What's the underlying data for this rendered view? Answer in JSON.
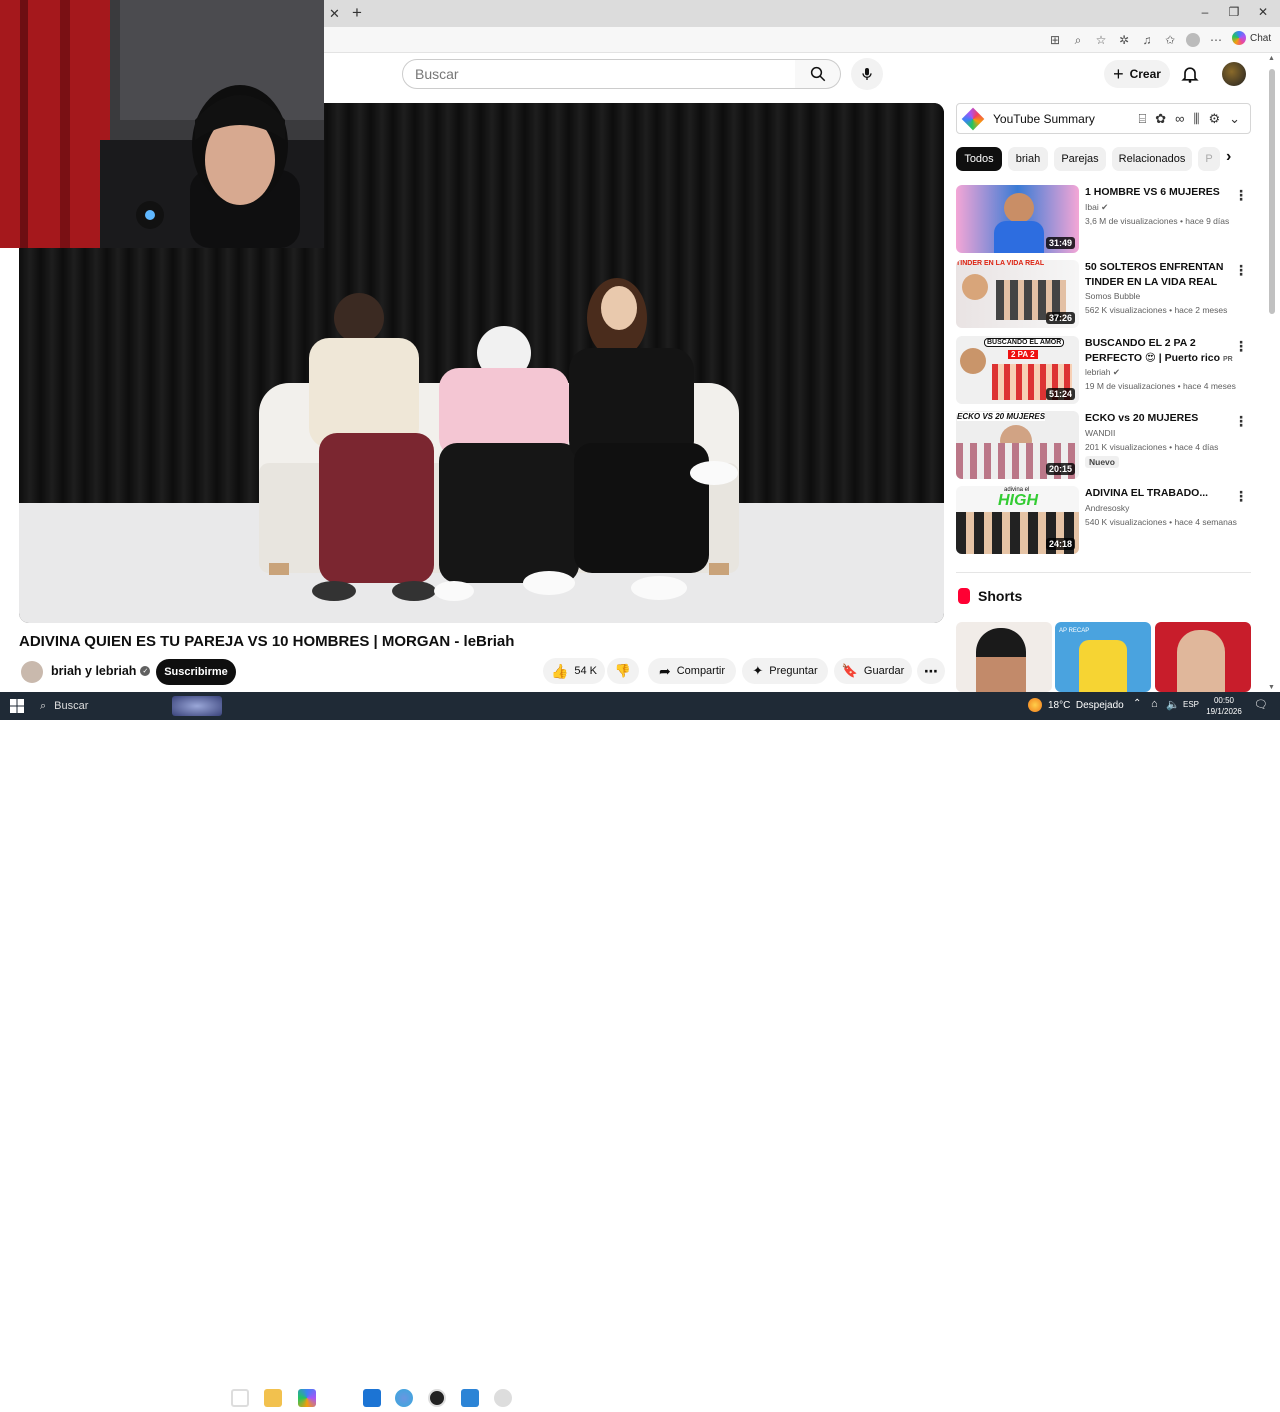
{
  "browser": {
    "chat_label": "Chat"
  },
  "header": {
    "search_placeholder": "Buscar",
    "create_label": "Crear"
  },
  "video": {
    "title": "ADIVINA QUIEN ES TU PAREJA VS 10 HOMBRES | MORGAN - leBriah",
    "channel": "briah y lebriah",
    "subscribe_label": "Suscribirme",
    "likes": "54 K",
    "share_label": "Compartir",
    "ask_label": "Preguntar",
    "save_label": "Guardar"
  },
  "sidebar": {
    "summary_label": "YouTube Summary",
    "chips": [
      "Todos",
      "briah",
      "Parejas",
      "Relacionados",
      "P"
    ],
    "recommendations": [
      {
        "title": "1 HOMBRE VS 6 MUJERES",
        "channel": "Ibai",
        "meta": "3,6 M de visualizaciones • hace 9 días",
        "duration": "31:49",
        "badge": ""
      },
      {
        "title": "50 SOLTEROS ENFRENTAN TINDER EN LA VIDA REAL",
        "channel": "Somos Bubble",
        "meta": "562 K visualizaciones • hace 2 meses",
        "duration": "37:26",
        "badge": ""
      },
      {
        "title": "BUSCANDO EL 2 PA 2 PERFECTO 😍 | Puerto rico",
        "channel": "lebriah",
        "meta": "19 M de visualizaciones • hace 4 meses",
        "duration": "51:24",
        "badge": ""
      },
      {
        "title": "ECKO vs 20 MUJERES",
        "channel": "WANDII",
        "meta": "201 K visualizaciones • hace 4 días",
        "duration": "20:15",
        "badge": "Nuevo"
      },
      {
        "title": "ADIVINA EL TRABADO...",
        "channel": "Andresosky",
        "meta": "540 K visualizaciones • hace 4 semanas",
        "duration": "24:18",
        "badge": ""
      }
    ],
    "thumb_texts": [
      "TINDER EN LA VIDA REAL",
      "BUSCANDO EL AMOR",
      "2 PA 2",
      "ECKO VS 20 MUJERES",
      "adivina el",
      "HIGH"
    ],
    "shorts_label": "Shorts",
    "short_thumb_text": "AP RECAP"
  },
  "taskbar": {
    "search_placeholder": "Buscar",
    "weather": "18°C  Despejado",
    "lang": "ESP",
    "time": "00:50",
    "date": "19/1/2026"
  },
  "colors": {
    "accent_red": "#ff0033",
    "taskbar": "#1f2a36"
  }
}
